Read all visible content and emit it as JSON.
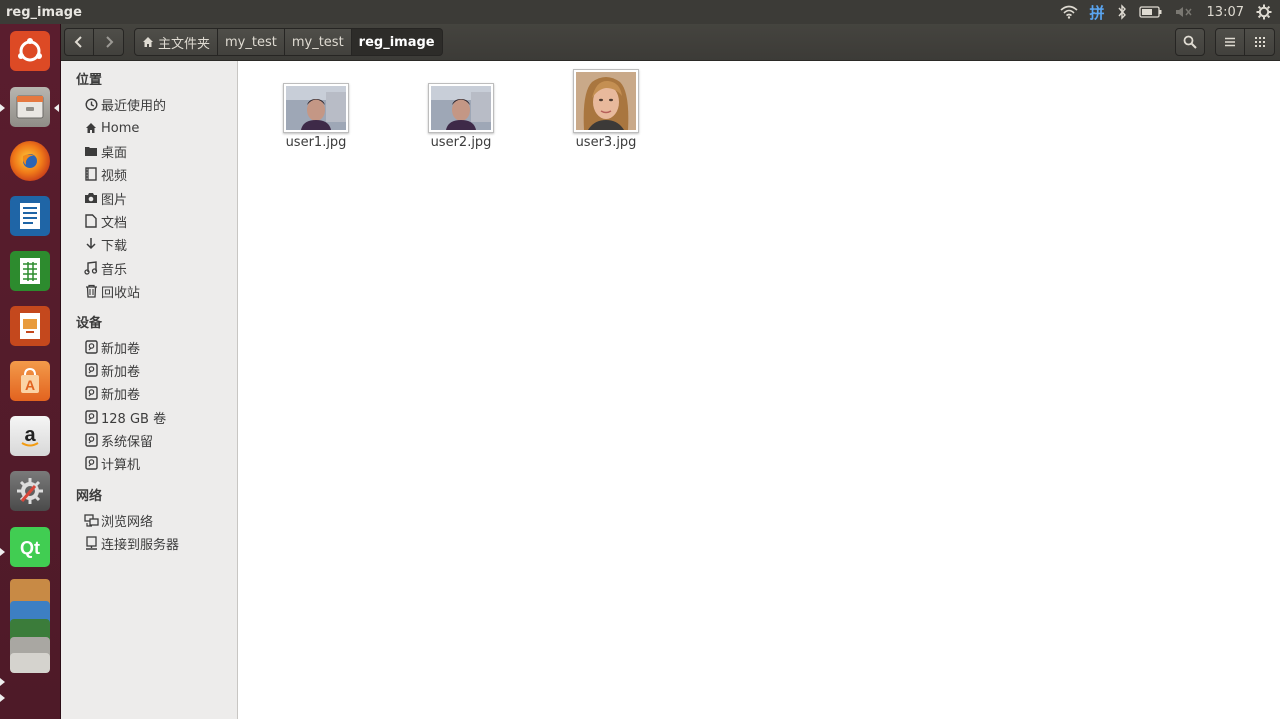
{
  "window_title": "reg_image",
  "indicators": {
    "input_method": "拼",
    "clock": "13:07"
  },
  "header": {
    "breadcrumbs": [
      "主文件夹",
      "my_test",
      "my_test",
      "reg_image"
    ]
  },
  "sidebar": {
    "places_title": "位置",
    "places": [
      "最近使用的",
      "Home",
      "桌面",
      "视频",
      "图片",
      "文档",
      "下载",
      "音乐",
      "回收站"
    ],
    "devices_title": "设备",
    "devices": [
      "新加卷",
      "新加卷",
      "新加卷",
      "128 GB 卷",
      "系统保留",
      "计算机"
    ],
    "network_title": "网络",
    "network": [
      "浏览网络",
      "连接到服务器"
    ]
  },
  "files": [
    {
      "name": "user1.jpg"
    },
    {
      "name": "user2.jpg"
    },
    {
      "name": "user3.jpg"
    }
  ],
  "colors": {
    "launcher": "#5a1d2e",
    "panel": "#3c3b37",
    "sidebar": "#edeceb",
    "accent_orange": "#e95420"
  }
}
